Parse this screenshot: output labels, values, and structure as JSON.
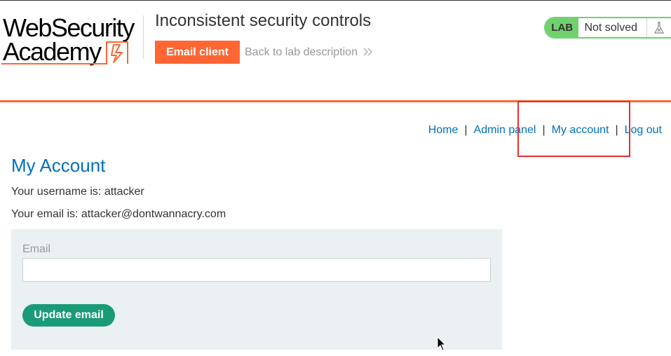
{
  "header": {
    "logo_line1": "WebSecurity",
    "logo_line2": "Academy",
    "lab_title": "Inconsistent security controls",
    "email_client_label": "Email client",
    "back_link_label": "Back to lab description",
    "lab_badge": "LAB",
    "lab_status": "Not solved"
  },
  "nav": {
    "items": [
      {
        "label": "Home"
      },
      {
        "label": "Admin panel"
      },
      {
        "label": "My account"
      },
      {
        "label": "Log out"
      }
    ],
    "separator": "|"
  },
  "account": {
    "title": "My Account",
    "username_line": "Your username is: attacker",
    "email_line": "Your email is: attacker@dontwannacry.com"
  },
  "form": {
    "email_label": "Email",
    "email_value": "",
    "submit_label": "Update email"
  },
  "colors": {
    "accent": "#ff6633",
    "link": "#0071bc",
    "lab_green": "#70d16d",
    "button_green": "#1a9b77",
    "form_bg": "#ebf0f2",
    "highlight_box": "#e0302f"
  },
  "icons": {
    "lab_flask": "flask-icon",
    "back_chevron": "double-chevron-right-icon",
    "logo_mark": "lightning-bolt-icon"
  }
}
